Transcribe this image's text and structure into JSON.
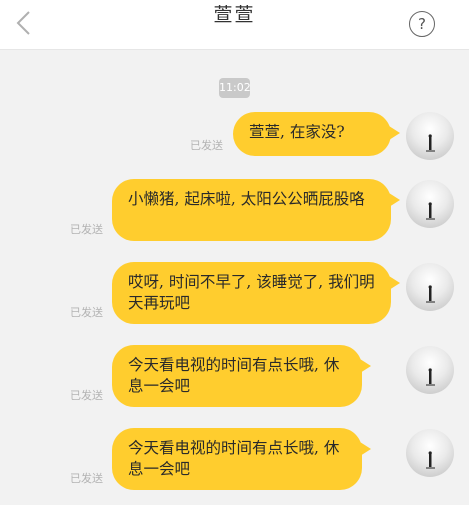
{
  "header": {
    "title": "萱萱",
    "back_icon": "chevron-left-icon",
    "help_icon": "question-circle-icon",
    "help_glyph": "?"
  },
  "time_chip": "11:02",
  "messages": [
    {
      "status": "已发送",
      "text": "萱萱, 在家没?"
    },
    {
      "status": "已发送",
      "text": "小懒猪, 起床啦, 太阳公公晒屁股咯"
    },
    {
      "status": "已发送",
      "text": "哎呀, 时间不早了, 该睡觉了, 我们明天再玩吧"
    },
    {
      "status": "已发送",
      "text": "今天看电视的时间有点长哦, 休息一会吧"
    },
    {
      "status": "已发送",
      "text": "今天看电视的时间有点长哦, 休息一会吧"
    }
  ],
  "colors": {
    "bubble": "#ffcd2e",
    "background": "#f2f2f2",
    "header": "#ffffff",
    "status_text": "#b3b3b3"
  }
}
